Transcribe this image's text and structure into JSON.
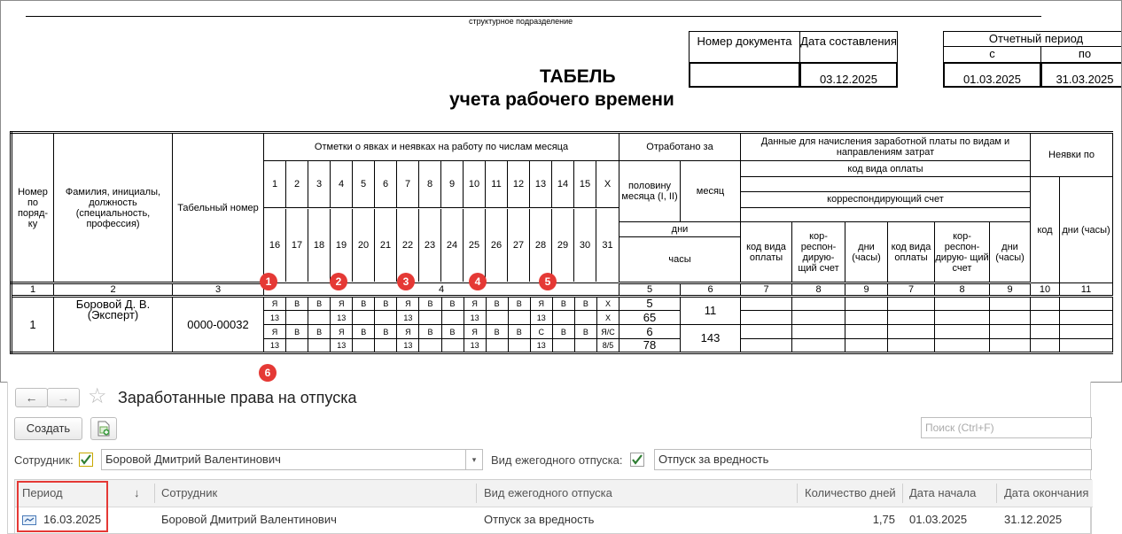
{
  "timesheet": {
    "subcaption": "структурное подразделение",
    "doc_number_label": "Номер документа",
    "doc_date_label": "Дата составления",
    "doc_date_value": "03.12.2025",
    "period_label": "Отчетный период",
    "period_from_label": "с",
    "period_to_label": "по",
    "period_from_value": "01.03.2025",
    "period_to_value": "31.03.2025",
    "title_line1": "ТАБЕЛЬ",
    "title_line2": "учета рабочего времени",
    "col_num": "Номер по поряд- ку",
    "col_name": "Фамилия, инициалы, должность (специальность, профессия)",
    "col_tab": "Табельный номер",
    "col_marks": "Отметки о явках и неявках на работу по числам месяца",
    "col_worked": "Отработано за",
    "col_half": "половину месяца (I, II)",
    "col_month": "месяц",
    "col_days": "дни",
    "col_hours": "часы",
    "col_pay": "Данные для начисления заработной платы по видам и направлениям затрат",
    "col_pay_code": "код вида оплаты",
    "col_corr": "корреспондирующий счет",
    "col_code_pay": "код вида оплаты",
    "col_corr_short": "кор- респон- дирую- щий счет",
    "col_days_hours": "дни (часы)",
    "col_absent": "Неявки по",
    "col_code": "код",
    "days_first": [
      "1",
      "2",
      "3",
      "4",
      "5",
      "6",
      "7",
      "8",
      "9",
      "10",
      "11",
      "12",
      "13",
      "14",
      "15",
      "X"
    ],
    "days_second": [
      "16",
      "17",
      "18",
      "19",
      "20",
      "21",
      "22",
      "23",
      "24",
      "25",
      "26",
      "27",
      "28",
      "29",
      "30",
      "31"
    ],
    "colnums": {
      "c1": "1",
      "c2": "2",
      "c3": "3",
      "c4": "4",
      "c5": "5",
      "c6": "6",
      "c7": "7",
      "c8": "8",
      "c9": "9",
      "c7b": "7",
      "c8b": "8",
      "c9b": "9",
      "c10": "10",
      "c11": "11"
    },
    "employee": {
      "num": "1",
      "name": "Боровой Д. В. (Эксперт)",
      "tab": "0000-00032",
      "row1": [
        "Я",
        "В",
        "В",
        "Я",
        "В",
        "В",
        "Я",
        "В",
        "В",
        "Я",
        "В",
        "В",
        "Я",
        "В",
        "В",
        "X"
      ],
      "row2": [
        "13",
        "",
        "",
        "13",
        "",
        "",
        "13",
        "",
        "",
        "13",
        "",
        "",
        "13",
        "",
        "",
        "X"
      ],
      "row3": [
        "Я",
        "В",
        "В",
        "Я",
        "В",
        "В",
        "Я",
        "В",
        "В",
        "Я",
        "В",
        "В",
        "С",
        "В",
        "В",
        "Я/С"
      ],
      "row4": [
        "13",
        "",
        "",
        "13",
        "",
        "",
        "13",
        "",
        "",
        "13",
        "",
        "",
        "13",
        "",
        "",
        "8/5"
      ],
      "half1_days": "5",
      "half1_hours": "65",
      "half2_days": "6",
      "half2_hours": "78",
      "month_days": "11",
      "month_hours": "143"
    },
    "badges": [
      "1",
      "2",
      "3",
      "4",
      "5",
      "6"
    ]
  },
  "app": {
    "back_icon": "←",
    "forward_icon": "→",
    "star_icon": "☆",
    "title": "Заработанные права на отпуска",
    "create_label": "Создать",
    "search_placeholder": "Поиск (Ctrl+F)",
    "employee_label": "Сотрудник:",
    "employee_value": "Боровой Дмитрий Валентинович",
    "vacation_label": "Вид ежегодного отпуска:",
    "vacation_value": "Отпуск за вредность",
    "columns": {
      "period": "Период",
      "employee": "Сотрудник",
      "vacation": "Вид ежегодного отпуска",
      "days": "Количество дней",
      "start": "Дата начала",
      "end": "Дата окончания"
    },
    "sort_icon": "↓",
    "row": {
      "period": "16.03.2025",
      "employee": "Боровой Дмитрий Валентинович",
      "vacation": "Отпуск за вредность",
      "days": "1,75",
      "start": "01.03.2025",
      "end": "31.12.2025"
    },
    "colors": {
      "highlight": "#e53935",
      "check": "#2e7d32",
      "badge": "#e53935"
    }
  }
}
